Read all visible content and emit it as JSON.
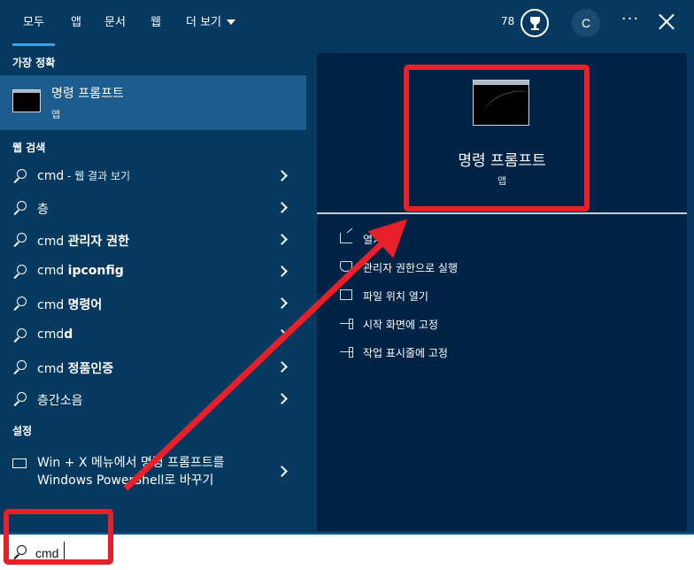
{
  "tabs": [
    {
      "label": "모두",
      "active": true
    },
    {
      "label": "앱"
    },
    {
      "label": "문서"
    },
    {
      "label": "웹"
    },
    {
      "label": "더 보기"
    }
  ],
  "header": {
    "points": "78",
    "avatar_initial": "C",
    "more_label": "···",
    "icons": [
      "trophy-icon",
      "more-icon",
      "close-icon"
    ]
  },
  "best_match": {
    "heading": "가장 정확",
    "title": "명령 프롬프트",
    "subtitle": "앱"
  },
  "web_search": {
    "heading": "웹 검색",
    "items": [
      {
        "pre": "cmd",
        "bold": "",
        "muted": " - 웹 결과 보기"
      },
      {
        "pre": "",
        "bold": "",
        "plain": "층"
      },
      {
        "pre": "cmd ",
        "bold": "관리자 권한"
      },
      {
        "pre": "cmd ",
        "bold": "ipconfig"
      },
      {
        "pre": "cmd ",
        "bold": "명령어"
      },
      {
        "pre": "cmd",
        "bold": "d"
      },
      {
        "pre": "cmd ",
        "bold": "정품인증"
      },
      {
        "pre": "",
        "bold": "",
        "plain": "층간소음"
      }
    ]
  },
  "settings": {
    "heading": "설정",
    "line1": "Win + X 메뉴에서 명령 프롬프트를",
    "line2": "Windows PowerShell로 바꾸기"
  },
  "detail": {
    "title": "명령 프롬프트",
    "subtitle": "앱",
    "actions": [
      {
        "label": "열기",
        "icon": "open-icon"
      },
      {
        "label": "관리자 권한으로 실행",
        "icon": "shield-icon"
      },
      {
        "label": "파일 위치 열기",
        "icon": "file-location-icon"
      },
      {
        "label": "시작 화면에 고정",
        "icon": "pin-icon"
      },
      {
        "label": "작업 표시줄에 고정",
        "icon": "pin-icon"
      }
    ]
  },
  "search": {
    "value": "cmd"
  },
  "colors": {
    "background": "#06395f",
    "selected": "#1d5d8e",
    "detail_panel": "#002346",
    "annotation": "#e8202a",
    "tab_underline": "#3c9ee8"
  }
}
